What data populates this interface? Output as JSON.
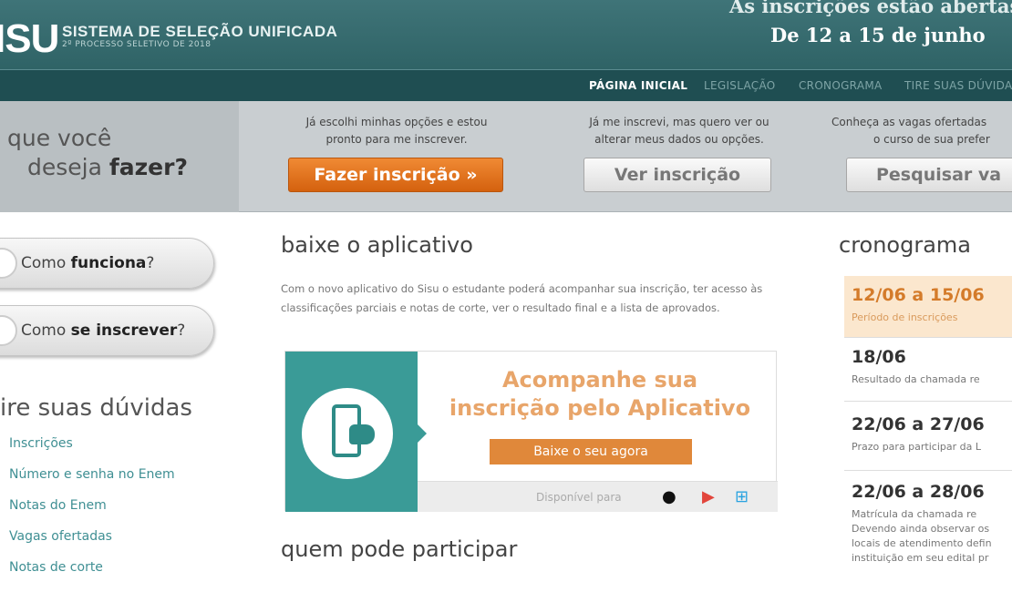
{
  "header": {
    "logo": "ISU",
    "title": "SISTEMA DE SELEÇÃO UNIFICADA",
    "subtitle": "2º PROCESSO SELETIVO DE 2018",
    "inscricoes_line1": "As inscrições estão abertas",
    "inscricoes_line2": "De 12 a 15 de junho"
  },
  "nav": {
    "items": [
      "PÁGINA INICIAL",
      "LEGISLAÇÃO",
      "CRONOGRAMA",
      "TIRE SUAS DÚVIDAS"
    ]
  },
  "actions": {
    "question_line1": "que você",
    "question_line2_pre": "deseja ",
    "question_line2_bold": "fazer?",
    "col1_text_line1": "Já escolhi minhas opções e estou",
    "col1_text_line2": "pronto para me inscrever.",
    "col1_button": "Fazer inscrição »",
    "col2_text_line1": "Já me inscrevi, mas quero ver ou",
    "col2_text_line2": "alterar meus dados ou opções.",
    "col2_button": "Ver inscrição",
    "col3_text_line1": "Conheça as vagas ofertadas",
    "col3_text_line2": "o curso de sua prefer",
    "col3_button": "Pesquisar va"
  },
  "left": {
    "pill1_pre": "Como ",
    "pill1_bold": "funciona",
    "pill1_post": "?",
    "pill2_pre": "Como ",
    "pill2_bold": "se inscrever",
    "pill2_post": "?",
    "duvidas_title": "ire suas dúvidas",
    "duvidas_items": [
      "Inscrições",
      "Número e senha no Enem",
      "Notas do Enem",
      "Vagas ofertadas",
      "Notas de corte"
    ]
  },
  "main": {
    "app_title": "baixe o aplicativo",
    "app_para": "Com o novo aplicativo do Sisu o estudante poderá acompanhar sua inscrição, ter acesso às classificações parciais e notas de corte, ver o resultado final e a lista de aprovados.",
    "banner_head_line1": "Acompanhe sua",
    "banner_head_line2": "inscrição pelo Aplicativo",
    "banner_button": "Baixe o seu agora",
    "banner_available": "Disponível para",
    "participar_title": "quem pode participar"
  },
  "cronograma": {
    "title": "cronograma",
    "items": [
      {
        "date": "12/06 a 15/06",
        "desc1": "Período de inscrições",
        "desc2": "",
        "desc3": "",
        "desc4": ""
      },
      {
        "date": "18/06",
        "desc1": "Resultado da chamada re",
        "desc2": "",
        "desc3": "",
        "desc4": ""
      },
      {
        "date": "22/06 a 27/06",
        "desc1": "Prazo para participar da L",
        "desc2": "",
        "desc3": "",
        "desc4": ""
      },
      {
        "date": "22/06 a 28/06",
        "desc1": "Matrícula da chamada re",
        "desc2": "Devendo ainda observar os",
        "desc3": "locais de atendimento defin",
        "desc4": "instituição em seu edital pr"
      }
    ]
  },
  "colors": {
    "header": "#2f6366",
    "nav": "#1f4e52",
    "orange": "#d4610e",
    "teal": "#3a9b97",
    "highlight": "#fbe7ce"
  }
}
